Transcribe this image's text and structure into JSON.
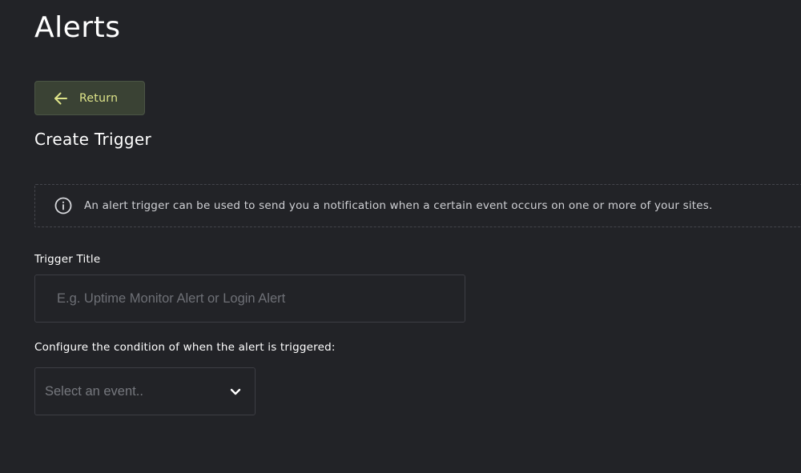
{
  "header": {
    "title": "Alerts"
  },
  "return_button": {
    "label": "Return",
    "icon": "arrow-left-icon"
  },
  "section": {
    "title": "Create Trigger"
  },
  "info": {
    "icon": "info-circle-icon",
    "text": "An alert trigger can be used to send you a notification when a certain event occurs on one or more of your sites."
  },
  "form": {
    "trigger_title": {
      "label": "Trigger Title",
      "placeholder": "E.g. Uptime Monitor Alert or Login Alert",
      "value": ""
    },
    "condition": {
      "label": "Configure the condition of when the alert is triggered:",
      "selected": "Select an event..",
      "icon": "chevron-down-icon"
    }
  },
  "colors": {
    "background": "#222327",
    "accent": "#dfe58a",
    "button_bg": "#3a4234",
    "text": "#ffffff",
    "muted": "#6e7076"
  }
}
